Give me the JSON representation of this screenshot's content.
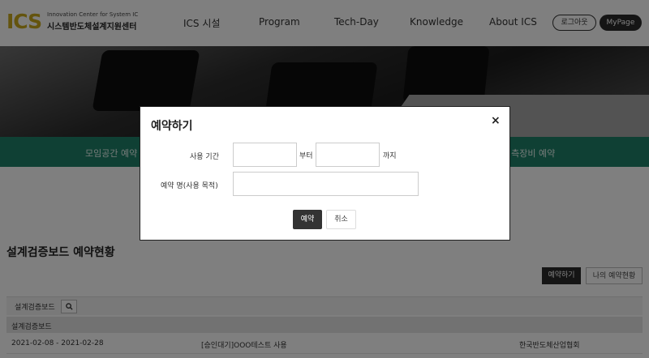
{
  "header": {
    "logo_mark": "ICS",
    "logo_line1": "Innovation Center for System IC",
    "logo_line2": "시스템반도체설계지원센터",
    "nav": [
      "ICS 시설",
      "Program",
      "Tech-Day",
      "Knowledge",
      "About ICS"
    ],
    "login_label": "로그아웃",
    "mypage_label": "MyPage"
  },
  "tabs": [
    "모임공간 예약",
    "계측장비 예약"
  ],
  "content": {
    "title": "설계검증보드 예약현황",
    "reserve_button": "예약하기",
    "my_reservations_button": "나의 예약현황",
    "filter_label": "설계검증보드",
    "search_icon": "magnifier-icon",
    "group_label": "설계검증보드",
    "row": {
      "period": "2021-02-08 - 2021-02-28",
      "name": "[승인대기]OOO테스트 사용",
      "org": "한국반도체산업협회"
    }
  },
  "modal": {
    "title": "예약하기",
    "close": "×",
    "period_label": "사용 기간",
    "from_label": "부터",
    "to_label": "까지",
    "from_value": "",
    "to_value": "",
    "purpose_label": "예약 명(사용 목적)",
    "purpose_value": "",
    "submit_label": "예약",
    "cancel_label": "취소"
  },
  "colors": {
    "accent_green": "#1f8068",
    "logo_gold": "#c8a91c",
    "dark_button": "#333333"
  }
}
